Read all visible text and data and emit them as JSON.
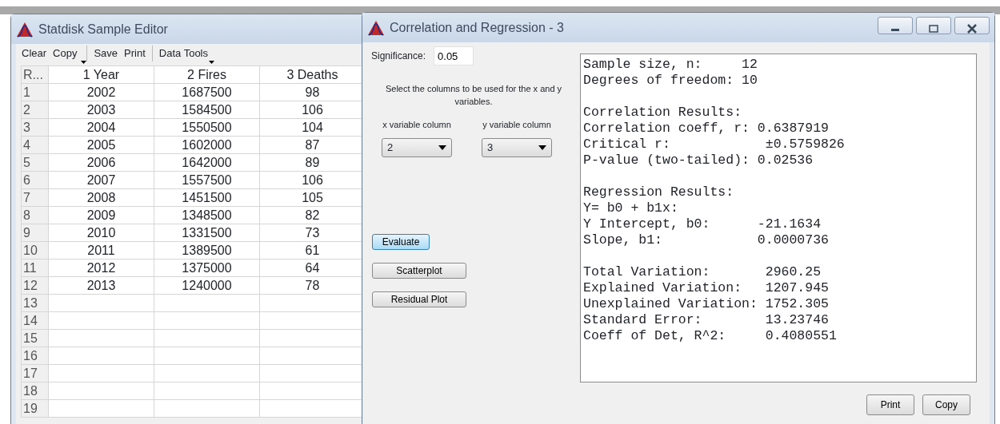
{
  "editor": {
    "title": "Statdisk Sample Editor",
    "toolbar": [
      {
        "label": "Clear",
        "dropdown": false,
        "separator_after": false
      },
      {
        "label": "Copy",
        "dropdown": true,
        "separator_after": true
      },
      {
        "label": "Save",
        "dropdown": false,
        "separator_after": false
      },
      {
        "label": "Print",
        "dropdown": false,
        "separator_after": true
      },
      {
        "label": "Data Tools",
        "dropdown": true,
        "separator_after": false
      }
    ],
    "columns": [
      "R...",
      "1 Year",
      "2 Fires",
      "3 Deaths"
    ],
    "rows": [
      [
        "1",
        "2002",
        "1687500",
        "98"
      ],
      [
        "2",
        "2003",
        "1584500",
        "106"
      ],
      [
        "3",
        "2004",
        "1550500",
        "104"
      ],
      [
        "4",
        "2005",
        "1602000",
        "87"
      ],
      [
        "5",
        "2006",
        "1642000",
        "89"
      ],
      [
        "6",
        "2007",
        "1557500",
        "106"
      ],
      [
        "7",
        "2008",
        "1451500",
        "105"
      ],
      [
        "8",
        "2009",
        "1348500",
        "82"
      ],
      [
        "9",
        "2010",
        "1331500",
        "73"
      ],
      [
        "10",
        "2011",
        "1389500",
        "61"
      ],
      [
        "11",
        "2012",
        "1375000",
        "64"
      ],
      [
        "12",
        "2013",
        "1240000",
        "78"
      ],
      [
        "13"
      ],
      [
        "14"
      ],
      [
        "15"
      ],
      [
        "16"
      ],
      [
        "17"
      ],
      [
        "18"
      ],
      [
        "19"
      ]
    ]
  },
  "dialog": {
    "title": "Correlation and Regression - 3",
    "significance_label": "Significance:",
    "significance_value": "0.05",
    "instructions": "Select the columns to be used for the x and y variables.",
    "x_label": "x variable column",
    "x_value": "2",
    "y_label": "y variable column",
    "y_value": "3",
    "actions": [
      {
        "label": "Evaluate",
        "focused": true
      },
      {
        "label": "Scatterplot",
        "focused": false
      },
      {
        "label": "Residual Plot",
        "focused": false
      }
    ],
    "results": [
      [
        "Sample size, n:     12",
        "Degrees of freedom: 10"
      ],
      [
        "Correlation Results:",
        "Correlation coeff, r: 0.6387919",
        "Critical r:            ±0.5759826",
        "P-value (two-tailed): 0.02536"
      ],
      [
        "Regression Results:",
        "Y= b0 + b1x:",
        "Y Intercept, b0:      -21.1634",
        "Slope, b1:            0.0000736"
      ],
      [
        "Total Variation:       2960.25",
        "Explained Variation:   1207.945",
        "Unexplained Variation: 1752.305",
        "Standard Error:        13.23746",
        "Coeff of Det, R^2:     0.4080551"
      ]
    ],
    "footer_buttons": [
      "Print",
      "Copy"
    ]
  }
}
